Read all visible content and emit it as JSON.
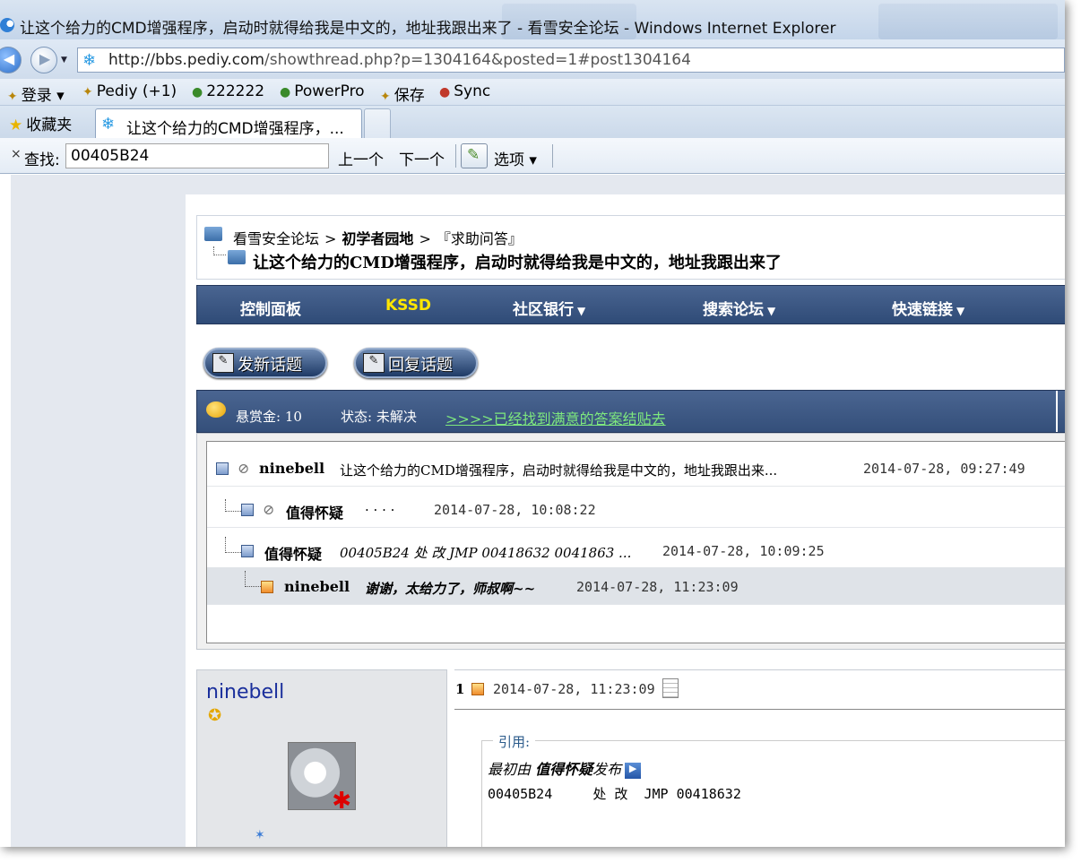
{
  "window": {
    "title": "让这个给力的CMD增强程序，启动时就得给我是中文的，地址我跟出来了 - 看雪安全论坛 - Windows Internet Explorer"
  },
  "address": {
    "host": "http://bbs.pediy.com",
    "path": "/showthread.php?p=1304164&posted=1#post1304164"
  },
  "links": [
    {
      "icon": "key-icon",
      "label": "登录 ▾"
    },
    {
      "icon": "pediy-icon",
      "label": "Pediy (+1)"
    },
    {
      "icon": "bookmark-icon",
      "label": "222222"
    },
    {
      "icon": "bookmark-icon",
      "label": "PowerPro"
    },
    {
      "icon": "save-icon",
      "label": "保存"
    },
    {
      "icon": "sync-icon",
      "label": "Sync"
    }
  ],
  "tabs": {
    "favorites_label": "收藏夹",
    "active_label": "让这个给力的CMD增强程序，..."
  },
  "find": {
    "label": "查找:",
    "value": "00405B24",
    "prev_label": "上一个",
    "next_label": "下一个",
    "options_label": "选项 ▾"
  },
  "breadcrumb": {
    "forum": "看雪安全论坛",
    "section": "初学者园地",
    "subsection": "『求助问答』",
    "thread_title": "让这个给力的CMD增强程序，启动时就得给我是中文的，地址我跟出来了"
  },
  "menu": [
    "控制面板",
    "KSSD",
    "社区银行",
    "搜索论坛",
    "快速链接"
  ],
  "buttons": {
    "new_topic": "发新话题",
    "reply": "回复话题"
  },
  "status": {
    "reward": "悬赏金: 10",
    "state": "状态: 未解决",
    "link": ">>>>已经找到满意的答案结贴去"
  },
  "tree": [
    {
      "user": "ninebell",
      "text": "让这个给力的CMD增强程序，启动时就得给我是中文的，地址我跟出来...",
      "date": "2014-07-28, 09:27:49"
    },
    {
      "user": "值得怀疑",
      "text": "· · · ·",
      "date": "2014-07-28, 10:08:22"
    },
    {
      "user": "值得怀疑",
      "text": "00405B24 处 改 JMP 00418632 0041863 ...",
      "date": "2014-07-28, 10:09:25"
    },
    {
      "user": "ninebell",
      "text": "谢谢，太给力了，师叔啊~~",
      "date": "2014-07-28, 11:23:09"
    }
  ],
  "post": {
    "author": "ninebell",
    "number": "1",
    "date": "2014-07-28, 11:23:09",
    "quote_label": "引用:",
    "quote_prefix": "最初由",
    "quote_author": "值得怀疑",
    "quote_suffix": "发布",
    "quote_text": "00405B24     处 改  JMP 00418632"
  }
}
